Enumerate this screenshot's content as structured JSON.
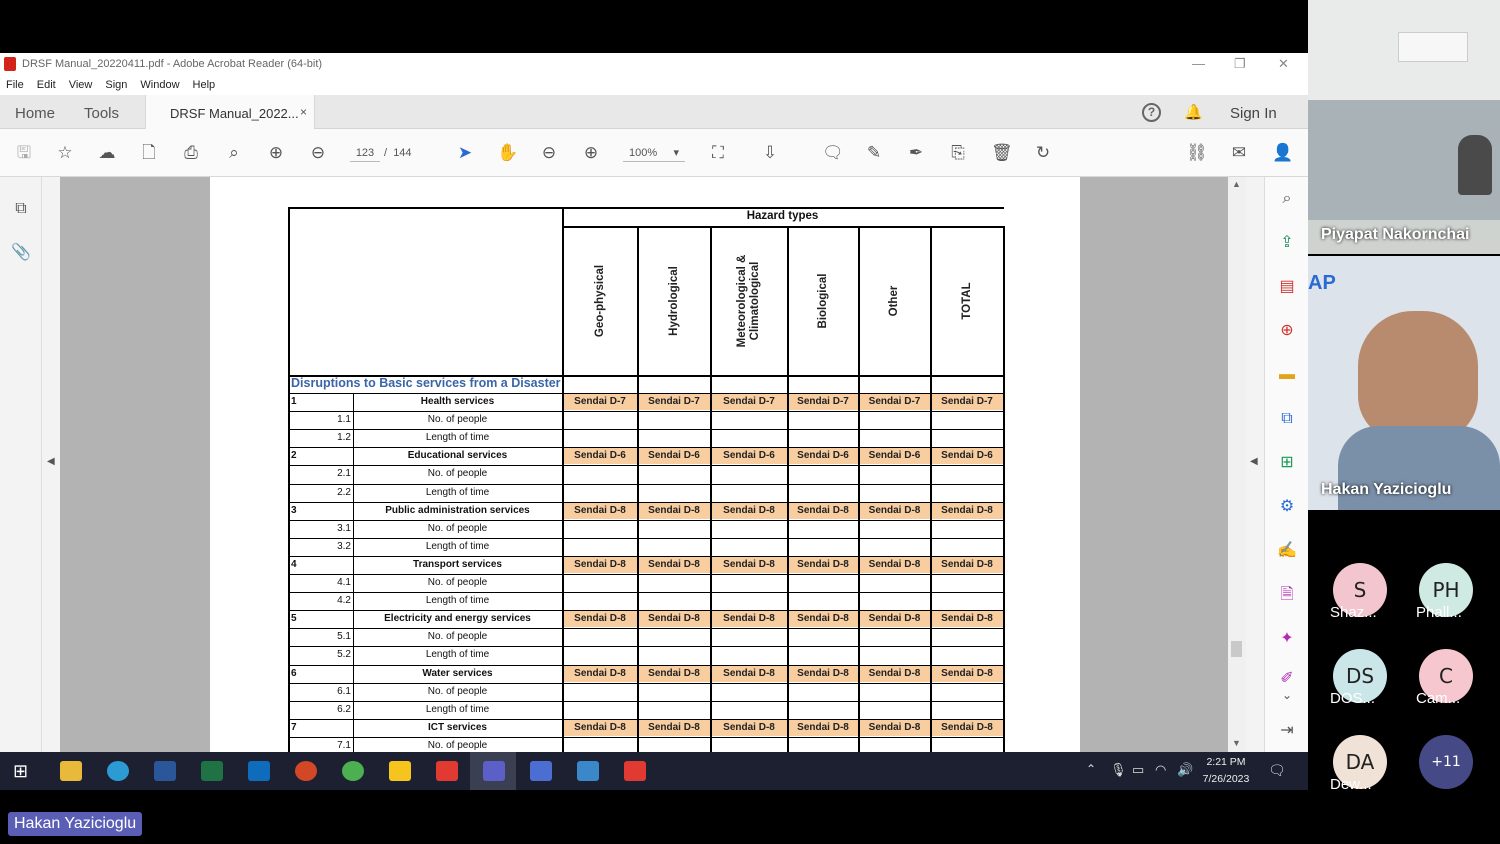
{
  "window": {
    "title": "DRSF Manual_20220411.pdf - Adobe Acrobat Reader (64-bit)"
  },
  "menu": [
    "File",
    "Edit",
    "View",
    "Sign",
    "Window",
    "Help"
  ],
  "tabs": {
    "home": "Home",
    "tools": "Tools",
    "document": "DRSF Manual_2022...",
    "close": "×",
    "sign_in": "Sign In"
  },
  "toolbar": {
    "page_current": "123",
    "page_separator": "/",
    "page_total": "144",
    "zoom": "100%"
  },
  "table": {
    "header": "Hazard types",
    "columns": [
      "Geo-physical",
      "Hydrological",
      "Meteorological &\nClimatological",
      "Biological",
      "Other",
      "TOTAL"
    ],
    "section_title": "Disruptions to Basic services from a Disaster",
    "rows": [
      {
        "num": "1",
        "label": "Health services",
        "code": "Sendai D-7",
        "sub": [
          {
            "num": "1.1",
            "label": "No. of people"
          },
          {
            "num": "1.2",
            "label": "Length of time"
          }
        ]
      },
      {
        "num": "2",
        "label": "Educational services",
        "code": "Sendai D-6",
        "sub": [
          {
            "num": "2.1",
            "label": "No. of people"
          },
          {
            "num": "2.2",
            "label": "Length of time"
          }
        ]
      },
      {
        "num": "3",
        "label": "Public administration services",
        "code": "Sendai D-8",
        "sub": [
          {
            "num": "3.1",
            "label": "No. of people"
          },
          {
            "num": "3.2",
            "label": "Length of time"
          }
        ]
      },
      {
        "num": "4",
        "label": "Transport services",
        "code": "Sendai D-8",
        "sub": [
          {
            "num": "4.1",
            "label": "No. of people"
          },
          {
            "num": "4.2",
            "label": "Length of time"
          }
        ]
      },
      {
        "num": "5",
        "label": "Electricity and energy services",
        "code": "Sendai D-8",
        "sub": [
          {
            "num": "5.1",
            "label": "No. of people"
          },
          {
            "num": "5.2",
            "label": "Length of time"
          }
        ]
      },
      {
        "num": "6",
        "label": "Water services",
        "code": "Sendai D-8",
        "sub": [
          {
            "num": "6.1",
            "label": "No. of people"
          },
          {
            "num": "6.2",
            "label": "Length of time"
          }
        ]
      },
      {
        "num": "7",
        "label": "ICT services",
        "code": "Sendai D-8",
        "sub": [
          {
            "num": "7.1",
            "label": "No. of people"
          }
        ]
      }
    ]
  },
  "taskbar": {
    "time": "2:21 PM",
    "date": "7/26/2023"
  },
  "meeting": {
    "participant1": "Piyapat Nakornchai",
    "participant2": "Hakan Yazicioglu",
    "attendees": [
      {
        "initials": "S",
        "name": "Shaz...",
        "color": "#f3c6cf"
      },
      {
        "initials": "PH",
        "name": "Phall...",
        "color": "#cfeae3"
      },
      {
        "initials": "DS",
        "name": "DOS...",
        "color": "#cbe6e8"
      },
      {
        "initials": "C",
        "name": "Cam...",
        "color": "#f7c7cf"
      },
      {
        "initials": "DA",
        "name": "Dew...",
        "color": "#f0e2d7"
      }
    ],
    "more": "+11",
    "speaker": "Hakan Yazicioglu"
  }
}
